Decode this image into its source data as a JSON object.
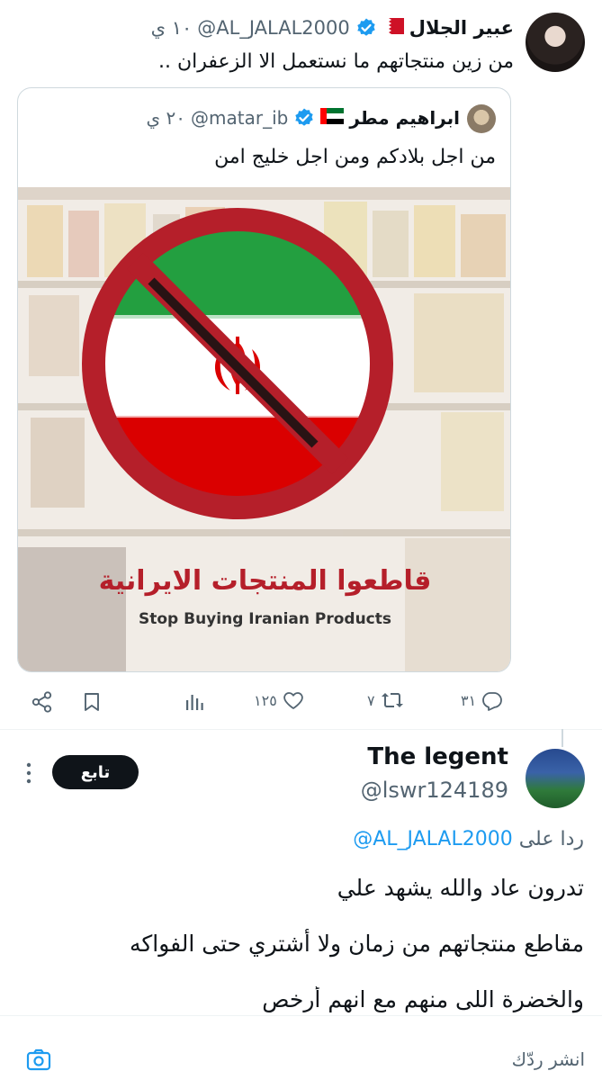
{
  "main_tweet": {
    "display_name": "عبير الجلال",
    "handle": "@AL_JALAL2000",
    "time": "١٠ ي",
    "text": "من زين منتجاتهم ما نستعمل الا الزعفران ..",
    "flag": "bahrain"
  },
  "quoted_tweet": {
    "display_name": "ابراهيم مطر",
    "handle": "@matar_ib",
    "time": "٢٠ ي",
    "text": "من اجل بلادكم ومن اجل خليج امن",
    "flag": "uae",
    "image": {
      "arabic_caption": "قاطعوا المنتجات الايرانية",
      "english_caption": "Stop Buying Iranian Products"
    }
  },
  "actions": {
    "replies": "٣١",
    "retweets": "٧",
    "likes": "١٢٥"
  },
  "reply_tweet": {
    "display_name": "The legent",
    "handle": "@lswr124189",
    "follow_label": "تابع",
    "replying_prefix": "ردا على",
    "replying_to": "@AL_JALAL2000",
    "lines": [
      "تدرون عاد والله يشهد علي",
      "مقاطع منتجاتهم من زمان ولا أشتري حتى الفواكه",
      "والخضرة اللى منهم مع انهم أرخص"
    ]
  },
  "composer": {
    "placeholder": "انشر ردّك"
  },
  "colors": {
    "accent": "#1d9bf0",
    "text": "#0f1419",
    "muted": "#536471",
    "ban_red": "#b51f2a",
    "iran_green": "#239f40",
    "iran_red": "#da0000"
  }
}
